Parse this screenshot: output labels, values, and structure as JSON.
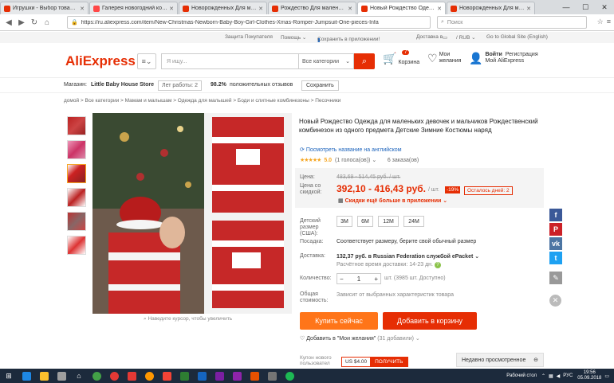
{
  "browser": {
    "tabs": [
      {
        "title": "Игрушки - Выбор товаров -",
        "active": false
      },
      {
        "title": "Галерея новогодний комбинезон",
        "active": false
      },
      {
        "title": "Новорожденных Для мальчиков",
        "active": false
      },
      {
        "title": "Рождество Для маленьких девоче",
        "active": false
      },
      {
        "title": "Новый Рождество Одежда для",
        "active": true
      },
      {
        "title": "Новорожденных Для мальчиков",
        "active": false
      }
    ],
    "url": "https://ru.aliexpress.com/item/New-Christmas-Newborn-Baby-Boy-Girl-Clothes-Xmas-Romper-Jumpsuit-One-pieces-Infa",
    "search_placeholder": "Поиск"
  },
  "utilbar": {
    "protection": "Защита Покупателя",
    "help": "Помощь ⌄",
    "app": "Сохранить в приложении!",
    "ship": "Доставка в",
    "currency": "/ RUB ⌄",
    "global": "Go to Global Site (English)"
  },
  "header": {
    "logo_main": "AliExpress",
    "search_placeholder": "Я ищу...",
    "category": "Все категории",
    "cart_label": "Корзина",
    "cart_count": "7",
    "wish_line1": "Мои",
    "wish_line2": "желания",
    "signin": "Войти",
    "register": "Регистрация",
    "my_ali": "Мой AliExpress"
  },
  "store": {
    "label": "Магазин:",
    "name": "Little Baby House Store",
    "years_label": "Лет работы: 2",
    "positive_pct": "98.2%",
    "positive_label": "положительных отзывов",
    "save_label": "Сохранить"
  },
  "breadcrumb": "домой  >  Все категории  >  Мамам и малышам  >  Одежда для малышей  >  Боди и слитные комбинезоны  >  Песочники",
  "product": {
    "title": "Новый Рождество Одежда для маленьких девочек и мальчиков Рождественский комбинезон из одного предмета Детские Зимние Костюмы наряд",
    "translate_link": "Посмотреть название на английском",
    "rating_score": "5.0",
    "rating_votes": "(1 голоса(ов)) ⌄",
    "orders": "6 заказа(ов)",
    "price_label": "Цена:",
    "old_price": "483,69 - 514,45 руб. / шт.",
    "discount_label": "Цена со скидкой:",
    "new_price": "392,10 - 416,43 руб.",
    "unit": "/ шт.",
    "discount_pct": "-19%",
    "days_left": "Осталось дней: 2",
    "app_discount": "Скидки ещё больше в приложении ⌄",
    "size_label": "Детский размер (США):",
    "sizes": [
      "3M",
      "6M",
      "12M",
      "24M"
    ],
    "fit_label": "Посадка:",
    "fit_value": "Соответствует размеру, берите свой обычный размер",
    "shipping_label": "Доставка:",
    "shipping_value": "132,37 руб. в Russian Federation службой ePacket ⌄",
    "shipping_time": "Расчётное время доставки: 14-23 дн.",
    "qty_label": "Количество:",
    "qty": "1",
    "qty_avail": "шт. (3985 шт. Доступно)",
    "total_label": "Общая стоимость:",
    "total_value": "Зависит от выбранных характеристик товара",
    "zoom_hint": "Наведите курсор, чтобы увеличить",
    "buy_now": "Купить сейчас",
    "add_cart": "Добавить в корзину",
    "wish_add": "Добавить в \"Мои желания\"",
    "wish_count": "(31 добавили) ⌄",
    "newuser_line1": "Купон нового",
    "newuser_line2": "пользовател",
    "coupon_amount": "US $4.00",
    "coupon_get": "ПОЛУЧИТЬ",
    "recent": "Недавно просмотренное"
  },
  "share_colors": {
    "facebook": "#3b5998",
    "pinterest": "#cb2027",
    "vk": "#4c75a3",
    "twitter": "#1da1f2",
    "edit": "#999999"
  },
  "taskbar": {
    "desktop": "Рабочий стол",
    "lang": "РУС",
    "time": "19:56",
    "date": "05.09.2018"
  }
}
